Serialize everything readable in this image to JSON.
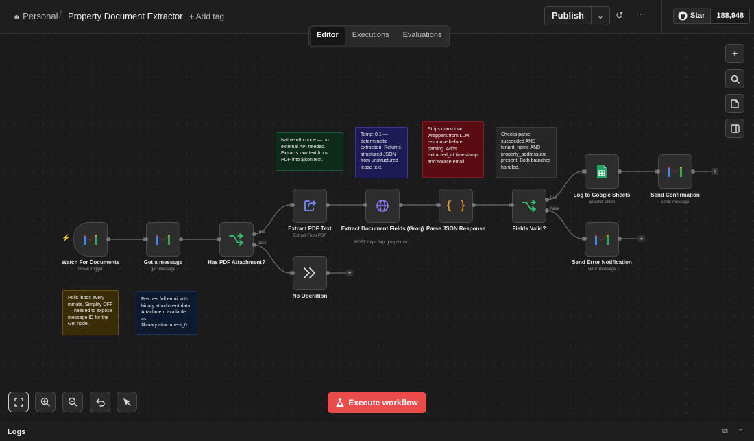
{
  "header": {
    "project": "Personal",
    "separator": "/",
    "workflow_title": "Property Document Extractor",
    "add_tag": "+ Add tag",
    "publish": "Publish",
    "github_star": "Star",
    "github_count": "188,948"
  },
  "tabs": [
    {
      "label": "Editor",
      "active": true
    },
    {
      "label": "Executions",
      "active": false
    },
    {
      "label": "Evaluations",
      "active": false
    }
  ],
  "nodes": {
    "watch": {
      "title": "Watch For Documents",
      "sub": "Gmail Trigger",
      "icon": "gmail-icon"
    },
    "get": {
      "title": "Get a message",
      "sub": "get: message",
      "icon": "gmail-icon"
    },
    "haspdf": {
      "title": "Has PDF Attachment?",
      "sub": "",
      "icon": "if-branch-icon",
      "true_label": "true",
      "false_label": "false"
    },
    "extractpdf": {
      "title": "Extract PDF Text",
      "sub": "Extract From PDF",
      "icon": "file-export-icon"
    },
    "noop": {
      "title": "No Operation",
      "sub": "",
      "icon": "double-chevron-icon"
    },
    "groq": {
      "title": "Extract Document Fields (Groq)",
      "sub": "POST: https://api.groq.com/o...",
      "icon": "globe-icon"
    },
    "parse": {
      "title": "Parse JSON Response",
      "sub": "",
      "icon": "code-braces-icon"
    },
    "valid": {
      "title": "Fields Valid?",
      "sub": "",
      "icon": "if-branch-icon",
      "true_label": "true",
      "false_label": "false"
    },
    "sheets": {
      "title": "Log to Google Sheets",
      "sub": "append: sheet",
      "icon": "google-sheets-icon"
    },
    "confirm": {
      "title": "Send Confirmation",
      "sub": "send: message",
      "icon": "gmail-icon"
    },
    "error": {
      "title": "Send Error Notification",
      "sub": "send: message",
      "icon": "gmail-icon"
    }
  },
  "stickies": {
    "pdf": "Native n8n node — no external API needed. Extracts raw text from PDF into $json.text.",
    "groq": "Temp: 0.1 — deterministic extraction. Returns structured JSON from unstructured lease text.",
    "parse": "Strips markdown wrappers from LLM response before parsing. Adds extracted_at timestamp and source email.",
    "valid": "Checks parse succeeded AND tenant_name AND property_address are present. Both branches handled.",
    "watch": "Polls inbox every minute. Simplify OFF — needed to expose message ID for the Get node.",
    "get": "Fetches full email with binary attachment data. Attachment available as $binary.attachment_0."
  },
  "toolbar": {
    "execute": "Execute workflow"
  },
  "logs": {
    "label": "Logs"
  },
  "colors": {
    "accent": "#ea4b4b",
    "canvas": "#1b1b1b",
    "node_bg": "#2d2d2d",
    "sticky_green": "#0d2a1a",
    "sticky_purple": "#1d1a55",
    "sticky_red": "#5a0c12",
    "sticky_gray": "#262626",
    "sticky_yellow": "#3a2c06",
    "sticky_navy": "#0c1a30"
  }
}
